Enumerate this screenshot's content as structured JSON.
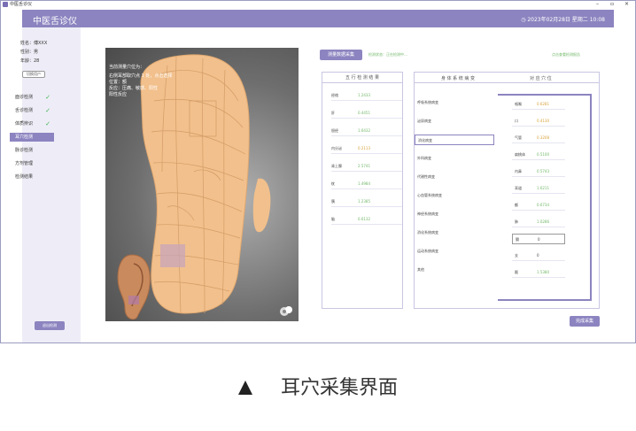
{
  "titlebar": {
    "title": "中医舌诊仪",
    "minimize": "–",
    "restore": "▫",
    "close": "×"
  },
  "header": {
    "brand": "中医舌诊仪",
    "datetime": "2023年02月28日  星期二  10:08"
  },
  "patient": {
    "name": "姓名：傅XXX",
    "gender": "性别：男",
    "age": "年龄：28",
    "switch_label": "切换用户"
  },
  "nav": [
    {
      "label": "面诊检测",
      "done": true
    },
    {
      "label": "舌诊检测",
      "done": true
    },
    {
      "label": "体质辨识",
      "done": true
    },
    {
      "label": "耳穴检测",
      "done": false,
      "active": true
    },
    {
      "label": "脉诊检测",
      "done": false
    },
    {
      "label": "方剂管理",
      "done": false
    },
    {
      "label": "检测结果",
      "done": false
    }
  ],
  "check_mark": "✓",
  "exit_label": "退出检测",
  "ear": {
    "hint_lines": [
      "当前测量穴位为：",
      "右侧耳部取穴点 1 处，点击选择",
      "位置：额",
      "反应：压痛、敏感、阳性",
      "阳性反应"
    ]
  },
  "top": {
    "measure_btn": "测量数据采集",
    "status_text": "检测状态：正在检测中…",
    "right_link": "点击查看检测报告"
  },
  "wuxing": {
    "title": "五 行 检 测 结 果",
    "rows": [
      {
        "k": "经络",
        "v": "1.2433",
        "c": "g"
      },
      {
        "k": "肝",
        "v": "0.4451",
        "c": "g"
      },
      {
        "k": "胆经",
        "v": "1.6432",
        "c": "g"
      },
      {
        "k": "内分泌",
        "v": "0.2113",
        "c": "y"
      },
      {
        "k": "肾上腺",
        "v": "2.5741",
        "c": "g"
      },
      {
        "k": "枕",
        "v": "1.4984",
        "c": "g"
      },
      {
        "k": "胰",
        "v": "1.2385",
        "c": "g"
      },
      {
        "k": "脑",
        "v": "0.6132",
        "c": "g"
      }
    ]
  },
  "system": {
    "col1": "身 体 系 统 病 变",
    "col2": "对 应 穴 位",
    "items": [
      "呼吸系统病变",
      "泌尿病变",
      "消化病变",
      "外科病变",
      "代谢性病变",
      "心血管系统病变",
      "神经系统病变",
      "消化系统病变",
      "运动系统病变",
      "其他"
    ],
    "selected_index": 2,
    "parts": [
      {
        "k": "咽喉",
        "v": "0.6281",
        "c": "y"
      },
      {
        "k": "口",
        "v": "0.4130",
        "c": "y"
      },
      {
        "k": "气管",
        "v": "0.3208",
        "c": "y"
      },
      {
        "k": "扁桃体",
        "v": "0.5100",
        "c": "g"
      },
      {
        "k": "内鼻",
        "v": "0.5743",
        "c": "g"
      },
      {
        "k": "耳道",
        "v": "1.6211",
        "c": "g"
      },
      {
        "k": "额",
        "v": "0.6734",
        "c": "g"
      },
      {
        "k": "肺",
        "v": "1.0286",
        "c": "g"
      },
      {
        "k": "膈",
        "v": "0",
        "c": "d",
        "boxed": true
      },
      {
        "k": "支",
        "v": "0",
        "c": "d"
      },
      {
        "k": "颞",
        "v": "1.5380",
        "c": "g"
      }
    ]
  },
  "next_btn": "完成采集",
  "caption": "耳穴采集界面"
}
